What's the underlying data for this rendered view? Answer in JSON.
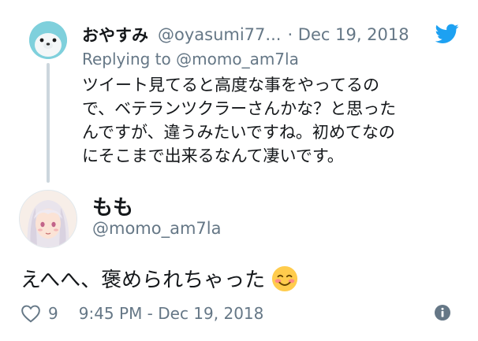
{
  "reply": {
    "name": "おやすみ",
    "handle": "@oyasumi77...",
    "date": "· Dec 19, 2018",
    "replying_to_prefix": "Replying to",
    "replying_to_handle": "@momo_am7la",
    "text_lines": [
      "ツイート見てると高度な事をやってるの",
      "で、ベテランツクラーさんかな？と思った",
      "んですが、違うみたいですね。初めてなの",
      "にそこまで出来るなんて凄いです。"
    ],
    "avatar_icon": "seal-avatar-icon"
  },
  "tweet": {
    "name": "もも",
    "handle": "@momo_am7la",
    "text": "えへへ、褒められちゃった",
    "emoji": "smiling-face-with-blush-icon",
    "avatar_icon": "anime-girl-avatar-icon",
    "likes": "9",
    "timestamp": "9:45 PM - Dec 19, 2018"
  },
  "colors": {
    "twitter_blue": "#1da1f2",
    "secondary_text": "#657786",
    "thread_line": "#ccd6dd"
  }
}
